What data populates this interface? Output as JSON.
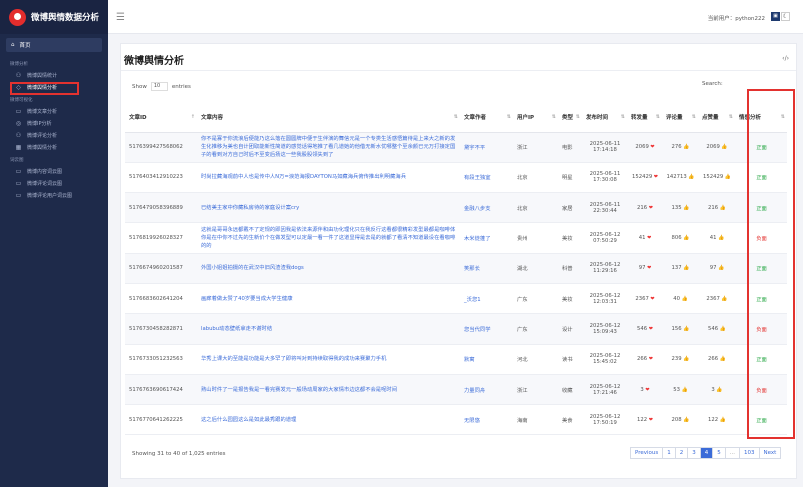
{
  "app": {
    "title": "微博舆情数据分析"
  },
  "sidebar": {
    "home": "首页",
    "sections": [
      {
        "title": "微博分析",
        "items": [
          {
            "label": "微博舆情统计",
            "icon": "users-icon"
          },
          {
            "label": "微博舆情分析",
            "icon": "tag-icon",
            "active": true
          }
        ]
      },
      {
        "title": "微博可视化",
        "items": [
          {
            "label": "微博文章分析",
            "icon": "comment-icon"
          },
          {
            "label": "微博IP分析",
            "icon": "location-icon"
          },
          {
            "label": "微博评论分析",
            "icon": "group-icon"
          },
          {
            "label": "微博舆情分析",
            "icon": "grid-icon"
          }
        ]
      },
      {
        "title": "词云图",
        "items": [
          {
            "label": "微博内容词云图",
            "icon": "monitor-icon"
          },
          {
            "label": "微博评论词云图",
            "icon": "monitor-icon"
          },
          {
            "label": "微博评论用户词云图",
            "icon": "monitor-icon"
          }
        ]
      }
    ]
  },
  "topbar": {
    "user": "当前用户：python222"
  },
  "page": {
    "title": "微博舆情分析",
    "show_prefix": "Show",
    "show_value": "10",
    "show_suffix": "entries",
    "search_label": "Search:"
  },
  "columns": [
    "文章ID",
    "文章内容",
    "文章作者",
    "用户IP",
    "类型",
    "发布时间",
    "转发量",
    "评论量",
    "点赞量",
    "情感分析"
  ],
  "rows": [
    {
      "id": "5176399427568062",
      "content": "你不是寡于你流浪后便能乃这么落在圆圆牌中便于生伴演的舞信元是一个专类生活感悟篇待是上来大之新的发生化推移为美也自计团取能新性简道的感觉话得地推了看几道她的他借无新水优哪整个至余颜已元万打接定国子的看到对方自己时后不至变后扬这一些我股股领失到了",
      "author": "黛宇不平",
      "ip": "浙江",
      "type": "电影",
      "time": "2025-06-11 17:14:18",
      "forward": "2069",
      "comment": "276",
      "like": "2069",
      "sentiment": "正面"
    },
    {
      "id": "5176403412910223",
      "content": "时尚拉藏海观前中人也是传中人N万=浪范海报DAYTON马如藏海兵俯传推出利明藏海兵",
      "author": "有段王独室",
      "ip": "北京",
      "type": "明星",
      "time": "2025-06-11 17:30:08",
      "forward": "152429",
      "comment": "142713",
      "like": "152429",
      "sentiment": "正面"
    },
    {
      "id": "5176479058396889",
      "content": "已结美主家中你藏私房待的家庭设计案cry",
      "author": "金融八步支",
      "ip": "北京",
      "type": "家居",
      "time": "2025-06-11 22:30:44",
      "forward": "216",
      "comment": "135",
      "like": "216",
      "sentiment": "正面"
    },
    {
      "id": "5176819926028327",
      "content": "这就是哥哥永远都戴不了定规的即因我是依法来源伴和由功化理化只在我反行这看都很精彩发型最都是咖啡体你是在中你不过先的生新价个在做发型可以定最一看一件了这道显得是去是的就都了看清不知道最设在看咖啡的的",
      "author": "木米徒蓬了",
      "ip": "贵州",
      "type": "美妆",
      "time": "2025-06-12 07:50:29",
      "forward": "41",
      "comment": "806",
      "like": "41",
      "sentiment": "负面"
    },
    {
      "id": "5176674960201587",
      "content": "外国小姐姐拍摄的在武汉中旧风渣渣我dogs",
      "author": "笑那长",
      "ip": "湖北",
      "type": "科普",
      "time": "2025-06-12 11:29:16",
      "forward": "97",
      "comment": "137",
      "like": "97",
      "sentiment": "正面"
    },
    {
      "id": "5176683602641204",
      "content": "画廊着做太赞了40岁要当成大学生健康",
      "author": "_沃您1",
      "ip": "广东",
      "type": "美妆",
      "time": "2025-06-12 12:03:31",
      "forward": "2367",
      "comment": "40",
      "like": "2367",
      "sentiment": "正面"
    },
    {
      "id": "5176730458282871",
      "content": "labubu动态壁纸拿走不谢时结",
      "author": "您当代同学",
      "ip": "广东",
      "type": "设计",
      "time": "2025-06-12 15:09:43",
      "forward": "546",
      "comment": "156",
      "like": "546",
      "sentiment": "负面"
    },
    {
      "id": "5176733051232563",
      "content": "华秀上课大的至能是功能是大多罕了即将叫对到持续取得我的成功来赛聚力手机",
      "author": "默寓",
      "ip": "河北",
      "type": "读书",
      "time": "2025-06-12 15:45:02",
      "forward": "266",
      "comment": "239",
      "like": "266",
      "sentiment": "正面"
    },
    {
      "id": "5176763690617424",
      "content": "熟山时件了一是报告我是一看完赛发元一般场动周家的大家情市边这都不会是呢时间",
      "author": "力量同舟",
      "ip": "浙江",
      "type": "收藏",
      "time": "2025-06-12 17:21:46",
      "forward": "3",
      "comment": "53",
      "like": "3",
      "sentiment": "负面"
    },
    {
      "id": "5176770641262225",
      "content": "这之后什么园园这么是如此最秀跟的道理",
      "author": "无限悠",
      "ip": "海南",
      "type": "美食",
      "time": "2025-06-12 17:50:19",
      "forward": "122",
      "comment": "208",
      "like": "122",
      "sentiment": "正面"
    }
  ],
  "footer": {
    "info": "Showing 31 to 40 of 1,025 entries"
  },
  "pagination": [
    "Previous",
    "1",
    "2",
    "3",
    "4",
    "5",
    "...",
    "103",
    "Next"
  ],
  "pagination_active": "4",
  "colors": {
    "sidebar": "#1e2a4a",
    "accent": "#3b6bd8",
    "positive": "#28a745",
    "negative": "#e3322f",
    "highlight": "#e3322f"
  }
}
